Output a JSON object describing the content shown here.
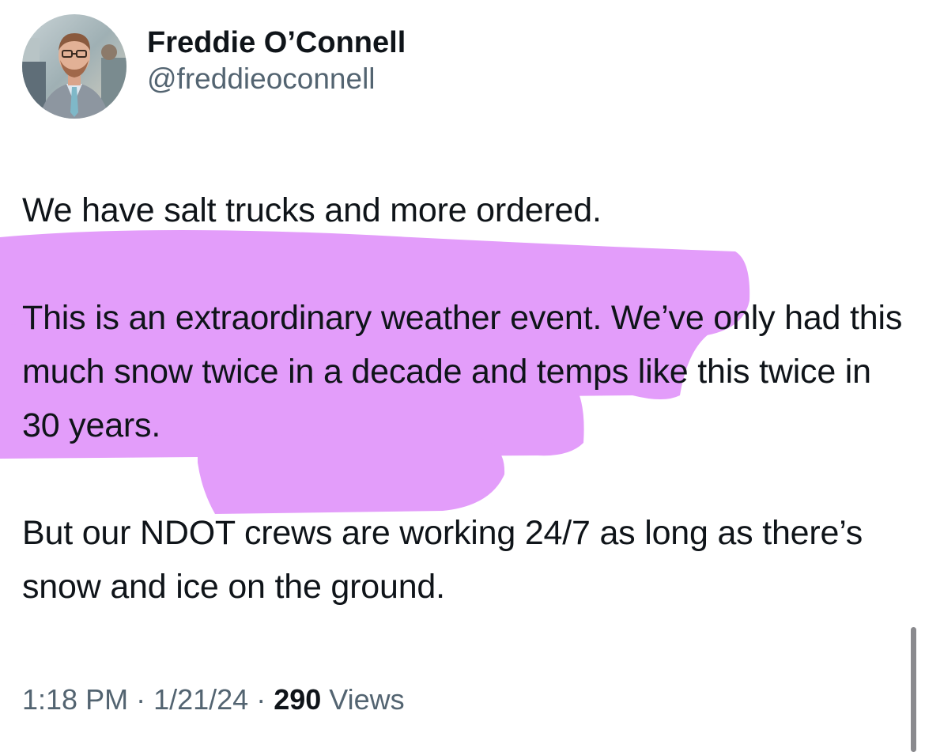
{
  "author": {
    "display_name": "Freddie O’Connell",
    "handle": "@freddieoconnell"
  },
  "tweet": {
    "paragraphs": [
      "We have salt trucks and more ordered.",
      "This is an extraordinary weather event. We’ve only had this much snow twice in a decade and temps like this twice in 30 years.",
      "But our NDOT crews are working 24/7 as long as there’s snow and ice on the ground."
    ]
  },
  "meta": {
    "time": "1:18 PM",
    "separator": "·",
    "date": "1/21/24",
    "views_count": "290",
    "views_label": "Views"
  },
  "colors": {
    "highlight": "#e298fa",
    "text": "#0f1419",
    "secondary_text": "#536471"
  },
  "icons": {
    "avatar": "profile-photo"
  }
}
